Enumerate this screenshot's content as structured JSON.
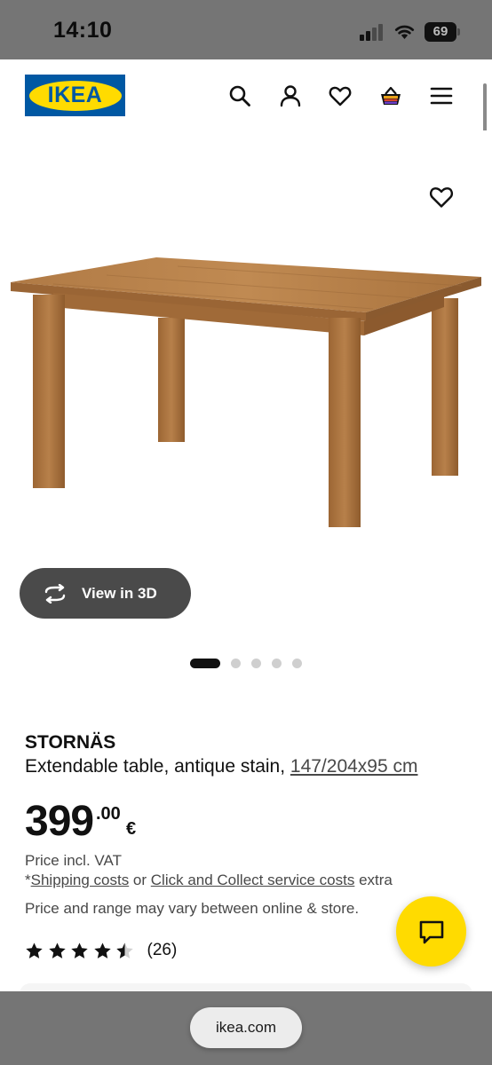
{
  "status_bar": {
    "time": "14:10",
    "battery": "69",
    "icons": [
      "signal-icon",
      "wifi-icon",
      "battery-icon"
    ]
  },
  "header": {
    "logo_text": "IKEA",
    "icons": [
      "search-icon",
      "account-icon",
      "favourites-icon",
      "basket-icon",
      "menu-icon"
    ]
  },
  "product_image": {
    "favourite_icon": "heart-icon",
    "view3d_label": "View in 3D",
    "carousel": {
      "total": 5,
      "active_index": 0
    }
  },
  "product": {
    "name": "STORNÄS",
    "description": "Extendable table, antique stain, ",
    "measurements": "147/204x95 cm",
    "price_integer": "399",
    "price_decimal": ".00",
    "currency": "€",
    "vat_text": "Price incl. VAT",
    "shipping_prefix": "*",
    "shipping_link": "Shipping costs",
    "shipping_or": " or ",
    "click_collect_link": "Click and Collect service costs",
    "shipping_suffix": " extra",
    "variation_text": "Price and range may vary between online & store.",
    "rating": {
      "stars": 4.5,
      "max": 5,
      "count": "(26)"
    }
  },
  "chat": {
    "icon": "chat-icon"
  },
  "browser": {
    "url": "ikea.com"
  },
  "colors": {
    "ikea_blue": "#0058a3",
    "ikea_yellow": "#ffdb00",
    "view3d_bg": "#4a4a4a",
    "system_bar": "#757575"
  }
}
